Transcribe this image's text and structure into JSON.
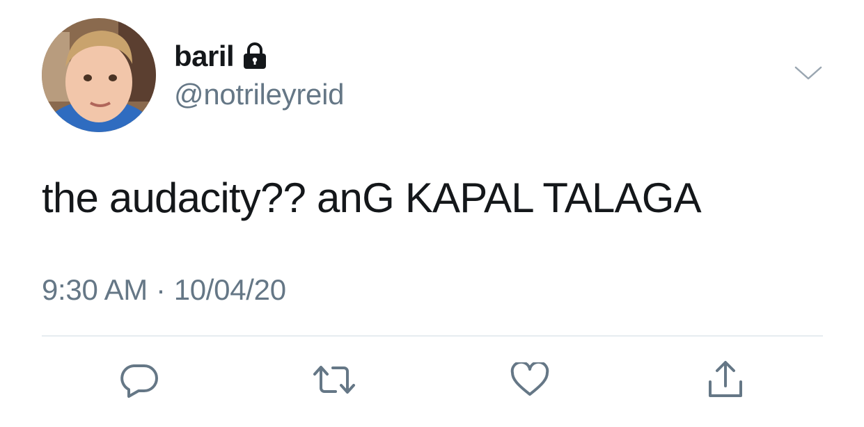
{
  "tweet": {
    "display_name": "baril",
    "handle": "@notrileyreid",
    "text": "the audacity?? anG KAPAL TALAGA",
    "time": "9:30 AM",
    "separator": "·",
    "date": "10/04/20"
  },
  "icons": {
    "lock": "lock-icon",
    "caret": "chevron-down-icon",
    "reply": "reply-icon",
    "retweet": "retweet-icon",
    "like": "heart-icon",
    "share": "share-icon"
  },
  "colors": {
    "text_primary": "#14171a",
    "text_secondary": "#657786",
    "icon_gray": "#657786",
    "divider": "#e6ecf0"
  }
}
